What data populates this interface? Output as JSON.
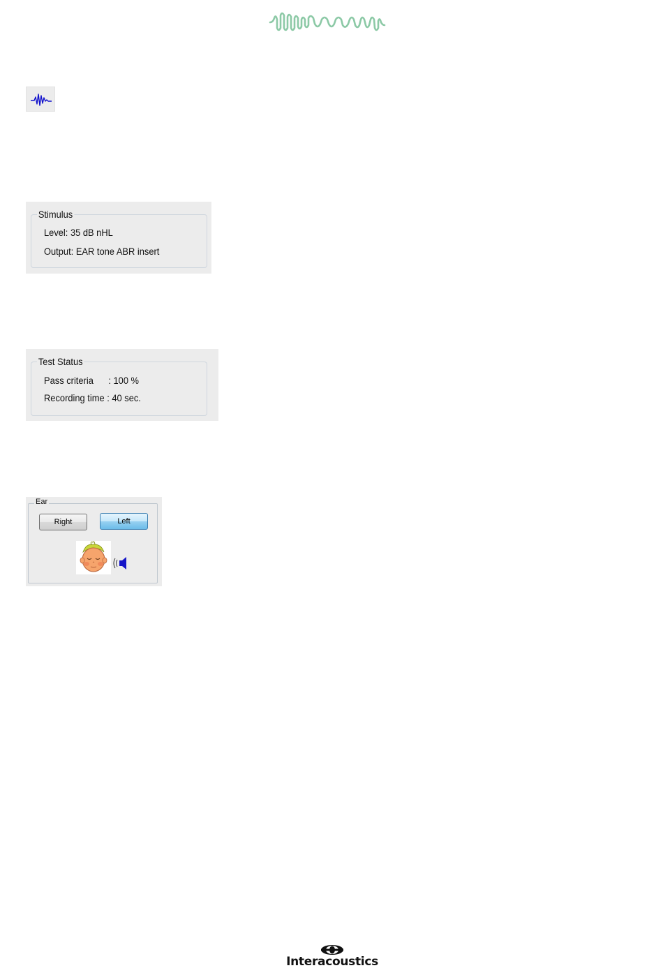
{
  "stimulus": {
    "legend": "Stimulus",
    "level": "Level: 35 dB nHL",
    "output": "Output: EAR tone ABR insert"
  },
  "test_status": {
    "legend": "Test Status",
    "pass_criteria": "Pass criteria      : 100 %",
    "recording_time": "Recording time : 40 sec."
  },
  "ear": {
    "legend": "Ear",
    "right_label": "Right",
    "left_label": "Left",
    "selected": "Left"
  },
  "footer": {
    "brand": "Interacoustics"
  },
  "icons": {
    "header": "wave-icon",
    "abr": "abr-waveform-icon",
    "baby": "baby-head-icon",
    "speaker": "speaker-icon",
    "logo": "interacoustics-logo-icon"
  },
  "colors": {
    "wave_green": "#8cc9a6",
    "abr_blue": "#1111cc",
    "selected_button": "#98d1f1"
  }
}
